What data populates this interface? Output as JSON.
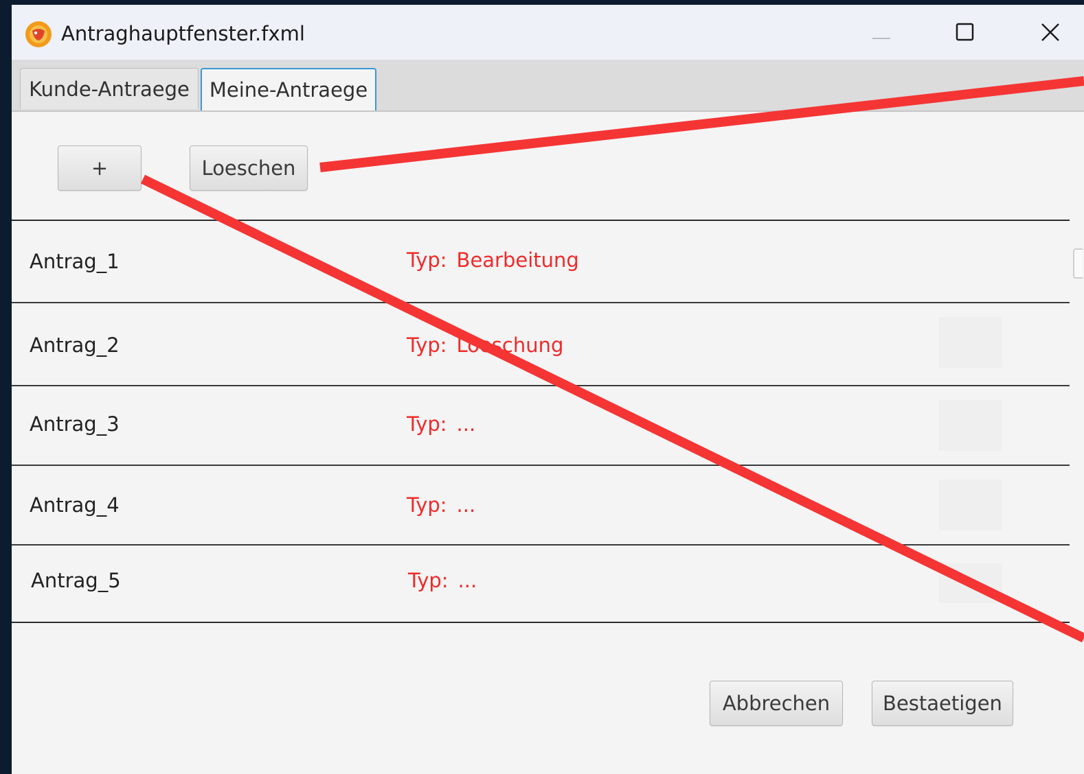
{
  "window": {
    "title": "Antraghauptfenster.fxml",
    "icon": "app-logo-icon",
    "controls": {
      "minimize_icon": "minimize-icon",
      "maximize_icon": "maximize-icon",
      "close_icon": "close-icon"
    }
  },
  "tabs": [
    {
      "label": "Kunde-Antraege",
      "selected": false
    },
    {
      "label": "Meine-Antraege",
      "selected": true
    }
  ],
  "toolbar": {
    "add_label": "+",
    "delete_label": "Loeschen"
  },
  "list": {
    "type_prefix": "Typ:",
    "rows": [
      {
        "name": "Antrag_1",
        "type": "Bearbeitung"
      },
      {
        "name": "Antrag_2",
        "type": "Loeschung"
      },
      {
        "name": "Antrag_3",
        "type": "..."
      },
      {
        "name": "Antrag_4",
        "type": "..."
      },
      {
        "name": "Antrag_5",
        "type": "..."
      }
    ]
  },
  "footer": {
    "cancel_label": "Abbrechen",
    "confirm_label": "Bestaetigen"
  },
  "colors": {
    "type_text": "#f02a2a",
    "annotation_line": "#f53434",
    "selected_tab_border": "#3a98d6"
  }
}
